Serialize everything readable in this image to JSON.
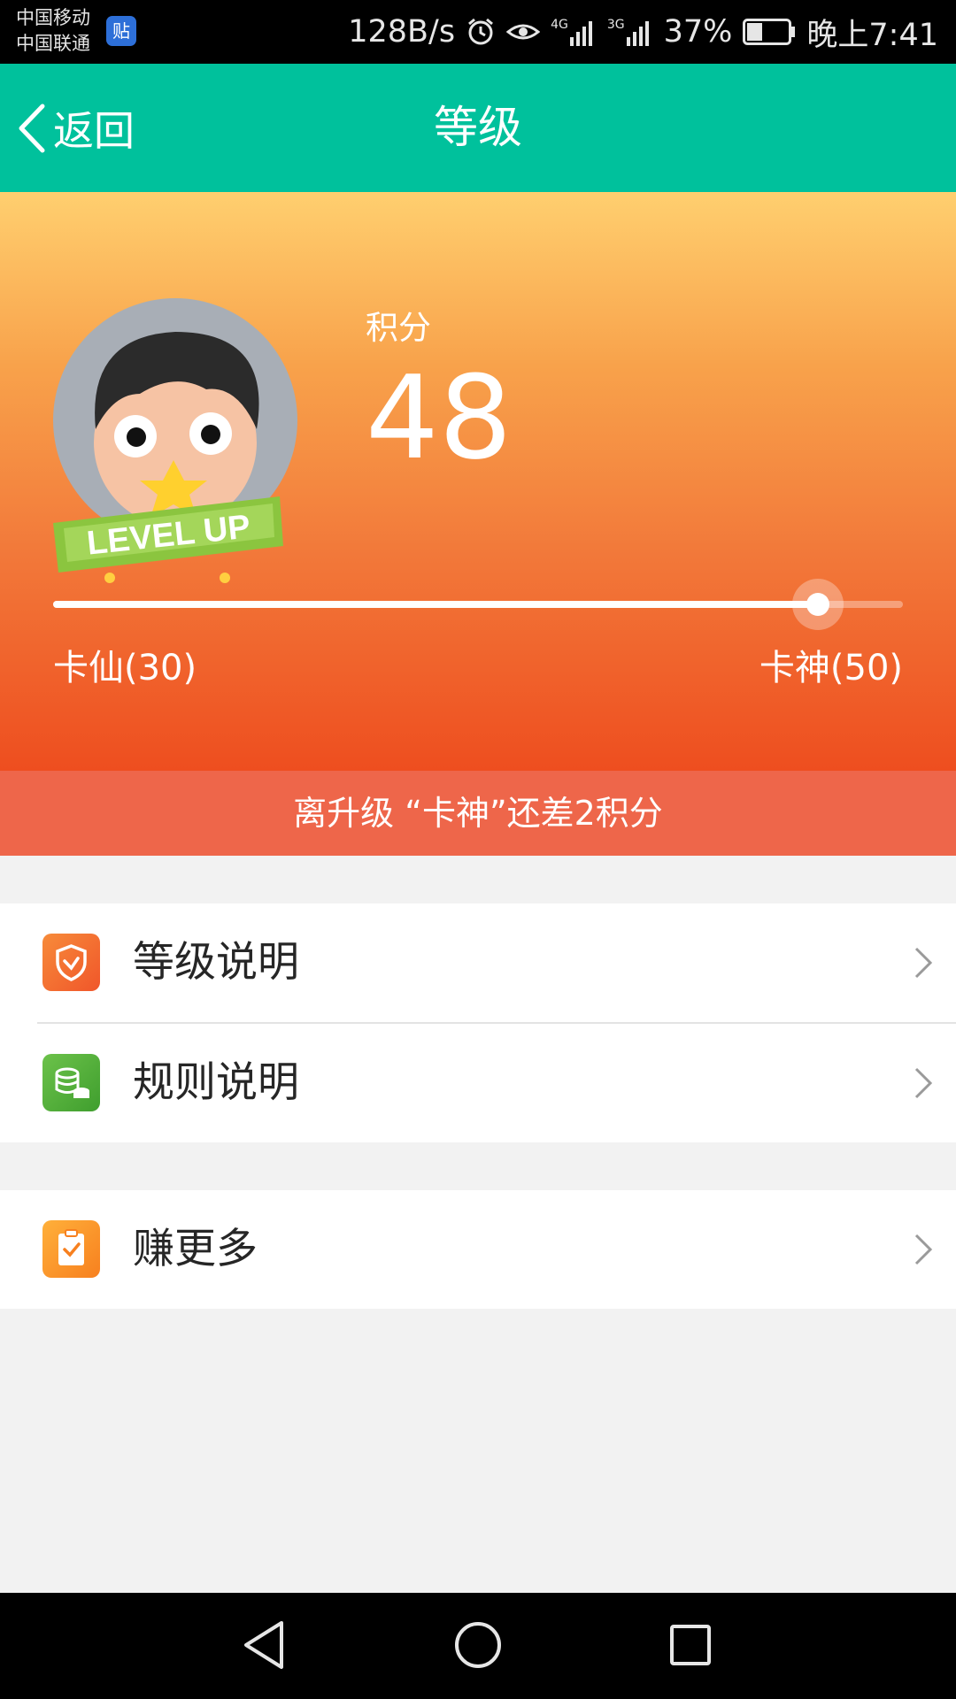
{
  "status_bar": {
    "carrier_1": "中国移动",
    "carrier_2": "中国联通",
    "notification_badge": "贴",
    "network_speed": "128B/s",
    "network_1": "4G",
    "network_2": "3G",
    "battery_percent": "37%",
    "battery_level": 0.37,
    "time": "晚上7:41"
  },
  "header": {
    "back_label": "返回",
    "title": "等级"
  },
  "profile": {
    "avatar_badge": "LEVEL UP",
    "points_label": "积分",
    "points_value": "48",
    "current_level": "卡仙(30)",
    "next_level": "卡神(50)",
    "progress_fraction": 0.9,
    "upgrade_notice": "离升级 “卡神”还差2积分"
  },
  "menu": {
    "group1": [
      {
        "label": "等级说明",
        "icon": "shield-icon",
        "color": "#f0562a"
      },
      {
        "label": "规则说明",
        "icon": "coins-icon",
        "color": "#4fb33b"
      }
    ],
    "group2": [
      {
        "label": "赚更多",
        "icon": "clipboard-check-icon",
        "color": "#f78b1f"
      }
    ]
  },
  "colors": {
    "header": "#00c19c",
    "banner": "#ee664a"
  }
}
